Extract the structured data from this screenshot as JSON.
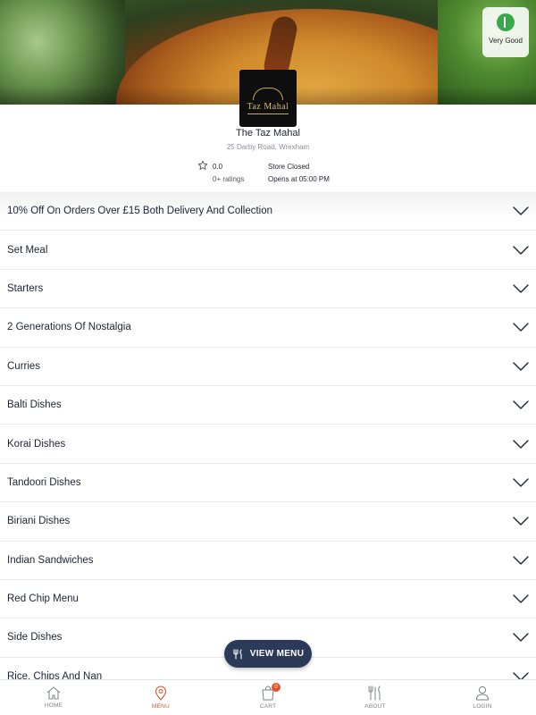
{
  "rating_badge": {
    "label": "Very Good",
    "color": "#3aa84a"
  },
  "logo": {
    "text": "Taz Mahal"
  },
  "store": {
    "name": "The Taz Mahal",
    "address": "25 Darby Road, Wrexham",
    "rating_value": "0.0",
    "ratings_count": "0+ ratings",
    "status": "Store Closed",
    "opens": "Opens at 05:00 PM"
  },
  "menu": {
    "categories": [
      "10% Off On Orders Over £15 Both Delivery And Collection",
      "Set Meal",
      "Starters",
      "2 Generations Of Nostalgia",
      "Curries",
      "Balti Dishes",
      "Korai Dishes",
      "Tandoori Dishes",
      "Biriani Dishes",
      "Indian Sandwiches",
      "Red Chip Menu",
      "Side Dishes",
      "Rice, Chips And Nan"
    ]
  },
  "view_menu_button": {
    "label": "VIEW MENU",
    "icon": "cutlery-icon",
    "color": "#2c3a5a"
  },
  "tabbar": {
    "accent": "#e1542b",
    "tabs": [
      {
        "label": "HOME",
        "icon": "home-icon"
      },
      {
        "label": "MENU",
        "icon": "location-pin-icon",
        "active": true
      },
      {
        "label": "CART",
        "icon": "bag-icon",
        "badge": "0"
      },
      {
        "label": "ABOUT",
        "icon": "cutlery-icon"
      },
      {
        "label": "LOGIN",
        "icon": "user-icon"
      }
    ]
  }
}
